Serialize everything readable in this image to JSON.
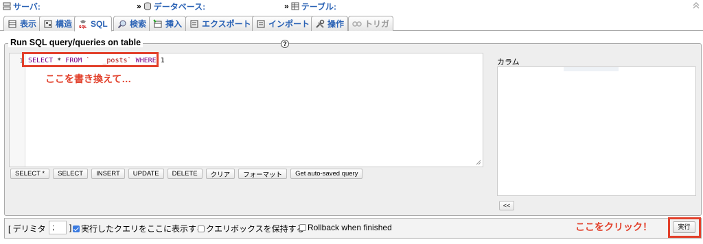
{
  "breadcrumb": {
    "server_label": "サーバ:",
    "database_label": "データベース:",
    "table_label": "テーブル:",
    "separator": "»",
    "collapse_icon": "double-chevron-up-icon"
  },
  "tabs": [
    {
      "label": "表示",
      "icon": "browse-icon",
      "active": false
    },
    {
      "label": "構造",
      "icon": "structure-icon",
      "active": false
    },
    {
      "label": "SQL",
      "icon": "sql-icon",
      "active": true
    },
    {
      "label": "検索",
      "icon": "search-icon",
      "active": false
    },
    {
      "label": "挿入",
      "icon": "insert-icon",
      "active": false
    },
    {
      "label": "エクスポート",
      "icon": "export-icon",
      "active": false
    },
    {
      "label": "インポート",
      "icon": "import-icon",
      "active": false
    },
    {
      "label": "操作",
      "icon": "operations-icon",
      "active": false
    },
    {
      "label": "トリガ",
      "icon": "triggers-icon",
      "active": false,
      "disabled": true
    }
  ],
  "sql_panel": {
    "legend": "Run SQL query/queries on table",
    "line_number": "1",
    "query": {
      "kw_select": "SELECT",
      "star": " * ",
      "kw_from": "FROM",
      "table": " `   _posts` ",
      "kw_where": "WHERE",
      "tail": " 1"
    },
    "buttons": [
      "SELECT *",
      "SELECT",
      "INSERT",
      "UPDATE",
      "DELETE",
      "クリア",
      "フォーマット",
      "Get auto-saved query"
    ]
  },
  "annotations": {
    "rewrite_note": "ここを書き換えて…",
    "click_note": "ここをクリック！"
  },
  "columns": {
    "label": "カラム",
    "insert_button": "<<"
  },
  "options": {
    "delimiter_label_start": "[ デリミタ",
    "delimiter_value": ";",
    "delimiter_label_end": "]",
    "show_query": {
      "label": "実行したクエリをここに表示する",
      "checked": true
    },
    "retain_box": {
      "label": "クエリボックスを保持する",
      "checked": false
    },
    "rollback": {
      "label": "Rollback when finished",
      "checked": false
    },
    "go_button": "実行"
  },
  "colors": {
    "accent": "#2a62b5",
    "annotation_red": "#e2402b",
    "checkbox_blue": "#3b7be0"
  }
}
